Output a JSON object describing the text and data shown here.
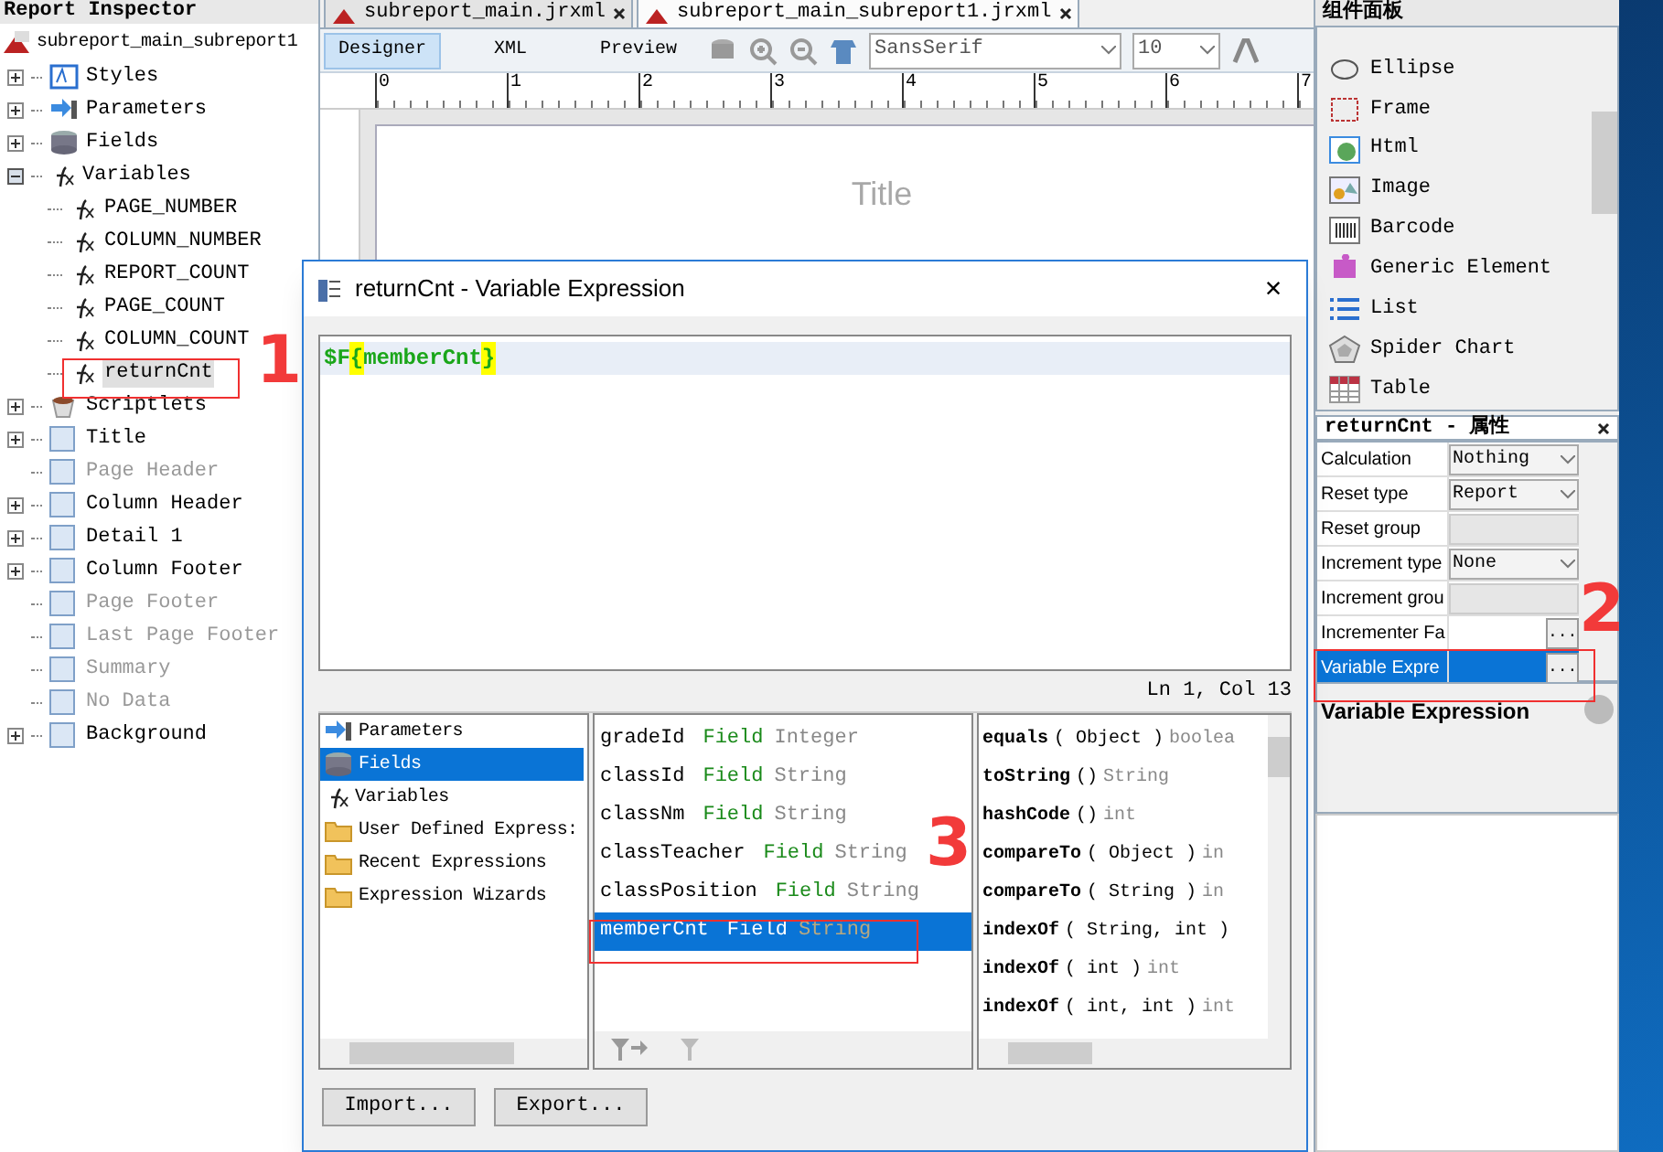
{
  "inspector": {
    "title": "Report Inspector",
    "root": "subreport_main_subreport1",
    "nodes": [
      {
        "label": "Styles",
        "kind": "styles",
        "expanded": false,
        "disabled": false
      },
      {
        "label": "Parameters",
        "kind": "parameters",
        "expanded": false,
        "disabled": false
      },
      {
        "label": "Fields",
        "kind": "fields",
        "expanded": false,
        "disabled": false
      },
      {
        "label": "Variables",
        "kind": "variables",
        "expanded": true,
        "disabled": false,
        "children": [
          {
            "label": "PAGE_NUMBER",
            "selected": false
          },
          {
            "label": "COLUMN_NUMBER",
            "selected": false
          },
          {
            "label": "REPORT_COUNT",
            "selected": false
          },
          {
            "label": "PAGE_COUNT",
            "selected": false
          },
          {
            "label": "COLUMN_COUNT",
            "selected": false
          },
          {
            "label": "returnCnt",
            "selected": true
          }
        ]
      },
      {
        "label": "Scriptlets",
        "kind": "scriptlets",
        "expanded": false,
        "disabled": false
      },
      {
        "label": "Title",
        "kind": "band",
        "expanded": false,
        "disabled": false
      },
      {
        "label": "Page Header",
        "kind": "band",
        "disabled": true
      },
      {
        "label": "Column Header",
        "kind": "band",
        "expanded": false,
        "disabled": false
      },
      {
        "label": "Detail 1",
        "kind": "band",
        "expanded": false,
        "disabled": false
      },
      {
        "label": "Column Footer",
        "kind": "band",
        "expanded": false,
        "disabled": false
      },
      {
        "label": "Page Footer",
        "kind": "band",
        "disabled": true
      },
      {
        "label": "Last Page Footer",
        "kind": "band",
        "disabled": true
      },
      {
        "label": "Summary",
        "kind": "band",
        "disabled": true
      },
      {
        "label": "No Data",
        "kind": "band",
        "disabled": true
      },
      {
        "label": "Background",
        "kind": "band",
        "expanded": false,
        "disabled": false
      }
    ]
  },
  "editor": {
    "tabs": [
      {
        "label": "subreport_main.jrxml",
        "selected": false
      },
      {
        "label": "subreport_main_subreport1.jrxml",
        "selected": true
      }
    ],
    "views": [
      {
        "label": "Designer",
        "selected": true
      },
      {
        "label": "XML",
        "selected": false
      },
      {
        "label": "Preview",
        "selected": false
      }
    ],
    "font": "SansSerif",
    "size": "10",
    "ruler": [
      "0",
      "1",
      "2",
      "3",
      "4",
      "5",
      "6",
      "7"
    ],
    "band_label": "Title"
  },
  "palette": {
    "title": "组件面板",
    "items": [
      {
        "label": "Ellipse"
      },
      {
        "label": "Frame"
      },
      {
        "label": "Html"
      },
      {
        "label": "Image"
      },
      {
        "label": "Barcode"
      },
      {
        "label": "Generic Element"
      },
      {
        "label": "List"
      },
      {
        "label": "Spider Chart"
      },
      {
        "label": "Table"
      }
    ]
  },
  "properties": {
    "title": "returnCnt - 属性",
    "rows": [
      {
        "name": "Calculation",
        "kind": "combo",
        "value": "Nothing",
        "selected": false
      },
      {
        "name": "Reset type",
        "kind": "combo",
        "value": "Report",
        "selected": false
      },
      {
        "name": "Reset group",
        "kind": "disabled",
        "selected": false
      },
      {
        "name": "Increment type",
        "kind": "combo",
        "value": "None",
        "selected": false
      },
      {
        "name": "Increment grou",
        "kind": "disabled",
        "selected": false
      },
      {
        "name": "Incrementer Fa",
        "kind": "dots",
        "value": "...",
        "selected": false
      },
      {
        "name": "Variable Expre",
        "kind": "dots",
        "value": "...",
        "selected": true
      }
    ],
    "description": "Variable Expression"
  },
  "dialog": {
    "title": "returnCnt - Variable Expression",
    "close": "✕",
    "expression": [
      {
        "text": "$F",
        "highlight": false
      },
      {
        "text": "{",
        "highlight": true
      },
      {
        "text": "memberCnt",
        "highlight": false
      },
      {
        "text": "}",
        "highlight": true
      }
    ],
    "cursor": "Ln 1, Col 13",
    "categories": [
      {
        "label": "Parameters",
        "kind": "parameters",
        "selected": false
      },
      {
        "label": "Fields",
        "kind": "fields",
        "selected": true
      },
      {
        "label": "Variables",
        "kind": "variables",
        "selected": false
      },
      {
        "label": "User Defined Express:",
        "kind": "folder",
        "selected": false
      },
      {
        "label": "Recent Expressions",
        "kind": "folder",
        "selected": false
      },
      {
        "label": "Expression Wizards",
        "kind": "folder",
        "selected": false
      }
    ],
    "objects": [
      {
        "name": "gradeId",
        "kind": "Field",
        "type": "Integer",
        "selected": false
      },
      {
        "name": "classId",
        "kind": "Field",
        "type": "String",
        "selected": false
      },
      {
        "name": "classNm",
        "kind": "Field",
        "type": "String",
        "selected": false
      },
      {
        "name": "classTeacher",
        "kind": "Field",
        "type": "String",
        "selected": false
      },
      {
        "name": "classPosition",
        "kind": "Field",
        "type": "String",
        "selected": false
      },
      {
        "name": "memberCnt",
        "kind": "Field",
        "type": "String",
        "selected": true
      }
    ],
    "methods": [
      {
        "name": "equals",
        "args": "( Object )",
        "ret": "boolea"
      },
      {
        "name": "toString",
        "args": "()",
        "ret": "String"
      },
      {
        "name": "hashCode",
        "args": "()",
        "ret": "int"
      },
      {
        "name": "compareTo",
        "args": "( Object )",
        "ret": "in"
      },
      {
        "name": "compareTo",
        "args": "( String )",
        "ret": "in"
      },
      {
        "name": "indexOf",
        "args": "( String, int )"
      },
      {
        "name": "indexOf",
        "args": "( int )",
        "ret": "int"
      },
      {
        "name": "indexOf",
        "args": "( int, int )",
        "ret": "int"
      }
    ],
    "buttons": [
      "Import...",
      "Export..."
    ]
  },
  "annotations": [
    {
      "label": "1"
    },
    {
      "label": "2"
    },
    {
      "label": "3"
    }
  ]
}
